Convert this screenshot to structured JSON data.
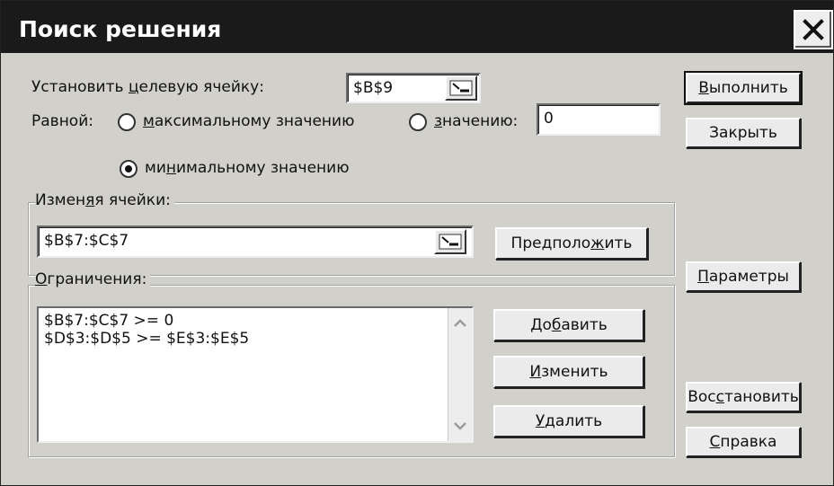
{
  "window": {
    "title": "Поиск решения"
  },
  "target": {
    "label_pre": "Установить ",
    "label_ul": "ц",
    "label_post": "елевую ячейку:",
    "value": "$B$9"
  },
  "equal_to": {
    "label": "Равной:",
    "max_pre": "",
    "max_ul": "м",
    "max_post": "аксимальному значению",
    "value_pre": "",
    "value_ul": "з",
    "value_post": "начению:",
    "value_field": "0",
    "min_pre": "ми",
    "min_ul": "н",
    "min_post": "имальному значению",
    "selected": "min"
  },
  "changing": {
    "label_pre": "Измен",
    "label_ul": "я",
    "label_post": "я ячейки:",
    "value": "$B$7:$C$7",
    "guess_pre": "Предполо",
    "guess_ul": "ж",
    "guess_post": "ить"
  },
  "constraints": {
    "label_pre": "",
    "label_ul": "О",
    "label_post": "граничения:",
    "items": [
      "$B$7:$C$7 >= 0",
      "$D$3:$D$5 >= $E$3:$E$5"
    ],
    "add_pre": "До",
    "add_ul": "б",
    "add_post": "авить",
    "change_pre": "",
    "change_ul": "И",
    "change_post": "зменить",
    "delete_pre": "",
    "delete_ul": "У",
    "delete_post": "далить"
  },
  "buttons": {
    "solve_pre": "",
    "solve_ul": "В",
    "solve_post": "ыполнить",
    "close": "Закрыть",
    "options_pre": "",
    "options_ul": "П",
    "options_post": "араметры",
    "reset_pre": "Вос",
    "reset_ul": "с",
    "reset_post": "тановить",
    "help_pre": "",
    "help_ul": "С",
    "help_post": "правка"
  },
  "icons": {
    "close": "close-icon",
    "ref": "collapse-dialog-icon",
    "scroll_up": "scroll-up-icon",
    "scroll_down": "scroll-down-icon"
  }
}
